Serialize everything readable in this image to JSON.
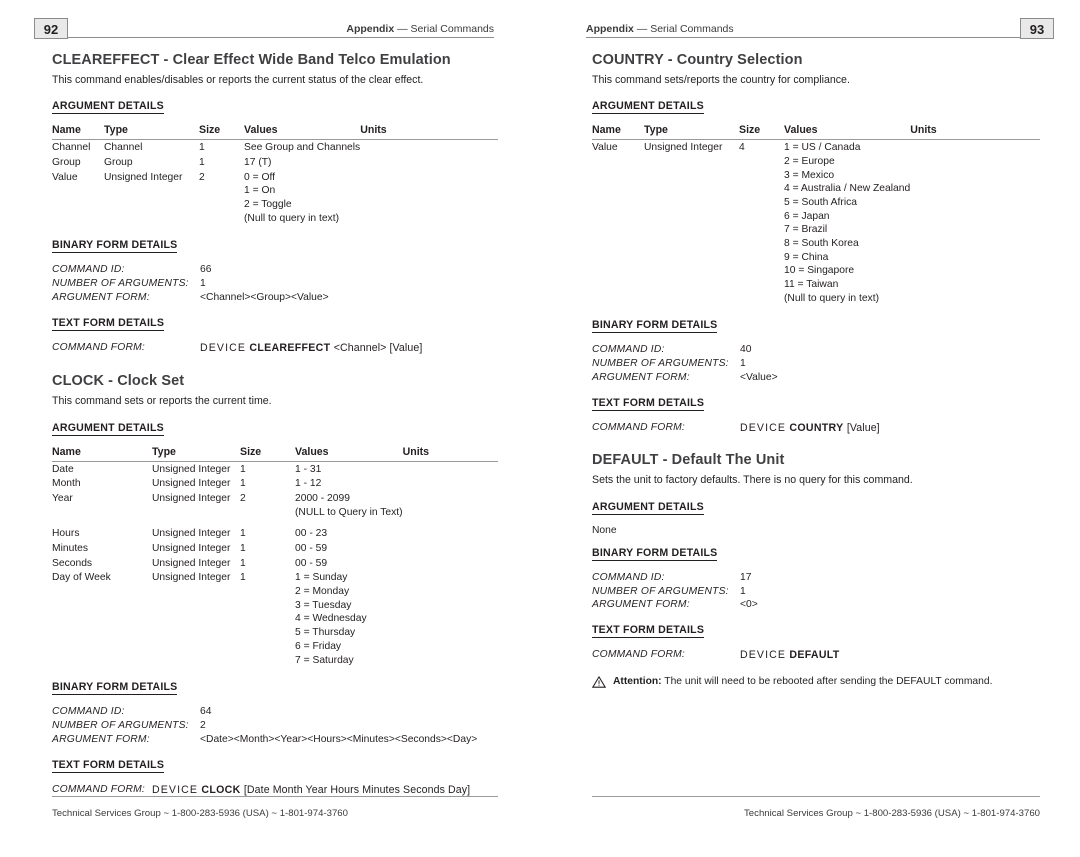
{
  "left_page": {
    "page_number": "92",
    "running_head_prefix": "Appendix",
    "running_head_sep": "—",
    "running_head_title": "Serial Commands",
    "footer": "Technical Services Group ~ 1-800-283-5936 (USA) ~ 1-801-974-3760",
    "sections": [
      {
        "title": "CLEAREFFECT - Clear Effect Wide Band Telco Emulation",
        "description": "This command enables/disables or reports the current status of the clear effect.",
        "argument_heading": "ARGUMENT DETAILS",
        "table": {
          "headers": [
            "Name",
            "Type",
            "Size",
            "Values",
            "Units"
          ],
          "rows": [
            {
              "name": "Channel",
              "type": "Channel",
              "size": "1",
              "values": "See Group and Channels",
              "units": ""
            },
            {
              "name": "Group",
              "type": "Group",
              "size": "1",
              "values": "17 (T)",
              "units": ""
            },
            {
              "name": "Value",
              "type": "Unsigned Integer",
              "size": "2",
              "values": "0 = Off\n1 = On\n2 = Toggle\n(Null to query in text)",
              "units": ""
            }
          ]
        },
        "binary_heading": "BINARY FORM DETAILS",
        "binary": {
          "command_id_label": "COMMAND ID:",
          "command_id_value": "66",
          "num_args_label": "NUMBER OF ARGUMENTS:",
          "num_args_value": "1",
          "arg_form_label": "ARGUMENT FORM:",
          "arg_form_value": "<Channel><Group><Value>"
        },
        "text_heading": "TEXT FORM DETAILS",
        "text_form": {
          "command_form_label": "COMMAND FORM:",
          "device": "DEVICE",
          "keyword": "CLEAREFFECT",
          "args": "<Channel> [Value]"
        }
      },
      {
        "title": "CLOCK - Clock Set",
        "description": "This command sets or reports the current time.",
        "argument_heading": "ARGUMENT DETAILS",
        "table": {
          "headers": [
            "Name",
            "Type",
            "Size",
            "Values",
            "Units"
          ],
          "rows": [
            {
              "name": "Date",
              "type": "Unsigned Integer",
              "size": "1",
              "values": "1 - 31",
              "units": ""
            },
            {
              "name": "Month",
              "type": "Unsigned Integer",
              "size": "1",
              "values": "1 - 12",
              "units": ""
            },
            {
              "name": "Year",
              "type": "Unsigned Integer",
              "size": "2",
              "values": "2000 - 2099\n(NULL to Query in Text)",
              "units": ""
            },
            {
              "name": "Hours",
              "type": "Unsigned Integer",
              "size": "1",
              "values": "00 - 23",
              "units": "",
              "gap_before": true
            },
            {
              "name": "Minutes",
              "type": "Unsigned Integer",
              "size": "1",
              "values": "00 - 59",
              "units": ""
            },
            {
              "name": "Seconds",
              "type": "Unsigned Integer",
              "size": "1",
              "values": "00 - 59",
              "units": ""
            },
            {
              "name": "Day of Week",
              "type": "Unsigned Integer",
              "size": "1",
              "values": "1 = Sunday\n2 = Monday\n3 = Tuesday\n4 = Wednesday\n5 = Thursday\n6 = Friday\n7 = Saturday",
              "units": ""
            }
          ]
        },
        "binary_heading": "BINARY FORM DETAILS",
        "binary": {
          "command_id_label": "COMMAND ID:",
          "command_id_value": "64",
          "num_args_label": "NUMBER OF ARGUMENTS:",
          "num_args_value": "2",
          "arg_form_label": "ARGUMENT FORM:",
          "arg_form_value": "<Date><Month><Year><Hours><Minutes><Seconds><Day>"
        },
        "text_heading": "TEXT FORM DETAILS",
        "text_form": {
          "command_form_label": "COMMAND FORM:",
          "device": "DEVICE",
          "keyword": "CLOCK",
          "args": "[Date Month Year Hours Minutes Seconds Day]"
        }
      }
    ]
  },
  "right_page": {
    "page_number": "93",
    "running_head_prefix": "Appendix",
    "running_head_sep": "—",
    "running_head_title": "Serial Commands",
    "footer": "Technical Services Group ~ 1-800-283-5936 (USA) ~ 1-801-974-3760",
    "sections": [
      {
        "title": "COUNTRY - Country Selection",
        "description": "This command sets/reports the country for compliance.",
        "argument_heading": "ARGUMENT DETAILS",
        "table": {
          "headers": [
            "Name",
            "Type",
            "Size",
            "Values",
            "Units"
          ],
          "rows": [
            {
              "name": "Value",
              "type": "Unsigned Integer",
              "size": "4",
              "values": "1 = US / Canada\n2 = Europe\n3 = Mexico\n4 = Australia / New Zealand\n5 = South Africa\n6 = Japan\n7 = Brazil\n8 = South Korea\n9 = China\n10 = Singapore\n11 = Taiwan\n(Null to query in text)",
              "units": ""
            }
          ]
        },
        "binary_heading": "BINARY FORM DETAILS",
        "binary": {
          "command_id_label": "COMMAND ID:",
          "command_id_value": "40",
          "num_args_label": "NUMBER OF ARGUMENTS:",
          "num_args_value": "1",
          "arg_form_label": "ARGUMENT FORM:",
          "arg_form_value": "<Value>"
        },
        "text_heading": "TEXT FORM DETAILS",
        "text_form": {
          "command_form_label": "COMMAND FORM:",
          "device": "DEVICE",
          "keyword": "COUNTRY",
          "args": "[Value]"
        }
      },
      {
        "title": "DEFAULT - Default The Unit",
        "description": "Sets the unit to factory defaults. There is no query for this command.",
        "argument_heading": "ARGUMENT DETAILS",
        "argument_none": "None",
        "binary_heading": "BINARY FORM DETAILS",
        "binary": {
          "command_id_label": "COMMAND ID:",
          "command_id_value": "17",
          "num_args_label": "NUMBER OF ARGUMENTS:",
          "num_args_value": "1",
          "arg_form_label": "ARGUMENT FORM:",
          "arg_form_value": "<0>"
        },
        "text_heading": "TEXT FORM DETAILS",
        "text_form": {
          "command_form_label": "COMMAND FORM:",
          "device": "DEVICE",
          "keyword": "DEFAULT",
          "args": ""
        },
        "attention": {
          "icon": "warning-triangle-icon",
          "label": "Attention:",
          "text": " The unit will need to be rebooted after sending the DEFAULT command."
        }
      }
    ]
  },
  "colors": {
    "text": "#231f20",
    "heading": "#403f41",
    "rule": "#8c8c8c",
    "pagenum_bg": "#e9e9e9"
  }
}
